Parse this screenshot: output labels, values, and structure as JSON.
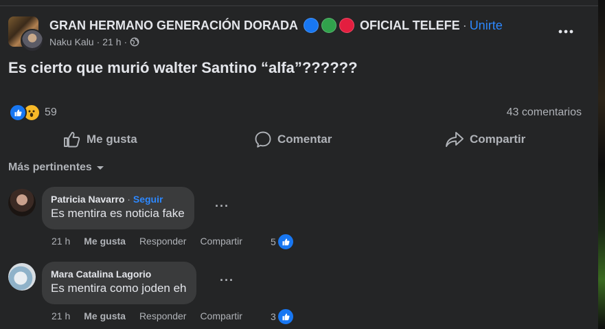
{
  "post": {
    "group_name": "GRAN HERMANO GENERACIÓN DORADA",
    "group_name_suffix": "OFICIAL TELEFE",
    "separator": "·",
    "join_label": "Unirte",
    "author": "Naku Kalu",
    "time": "21 h",
    "text": "Es cierto que murió walter Santino “alfa”??????",
    "reaction_count": "59",
    "comment_count": "43 comentarios",
    "emoji_dots": [
      "#1877f2",
      "#31a24c",
      "#e41e3f"
    ]
  },
  "actions": {
    "like": "Me gusta",
    "comment": "Comentar",
    "share": "Compartir"
  },
  "sort_label": "Más pertinentes",
  "comments": [
    {
      "author": "Patricia Navarro",
      "follow": "Seguir",
      "text": "Es mentira es noticia fake",
      "time": "21 h",
      "like": "Me gusta",
      "reply": "Responder",
      "share": "Compartir",
      "likes": "5"
    },
    {
      "author": "Mara Catalina Lagorio",
      "text": "Es mentira como joden eh",
      "time": "21 h",
      "like": "Me gusta",
      "reply": "Responder",
      "share": "Compartir",
      "likes": "3"
    }
  ],
  "icons": {
    "more": "more-horizontal-icon",
    "globe": "globe-icon",
    "like": "thumbs-up-icon",
    "comment": "comment-bubble-icon",
    "share": "share-arrow-icon",
    "caret": "caret-down-icon"
  },
  "colors": {
    "background": "#242526",
    "bubble": "#3a3b3c",
    "link": "#2d88ff",
    "like_blue": "#1877f2",
    "wow_yellow": "#f7b928"
  }
}
